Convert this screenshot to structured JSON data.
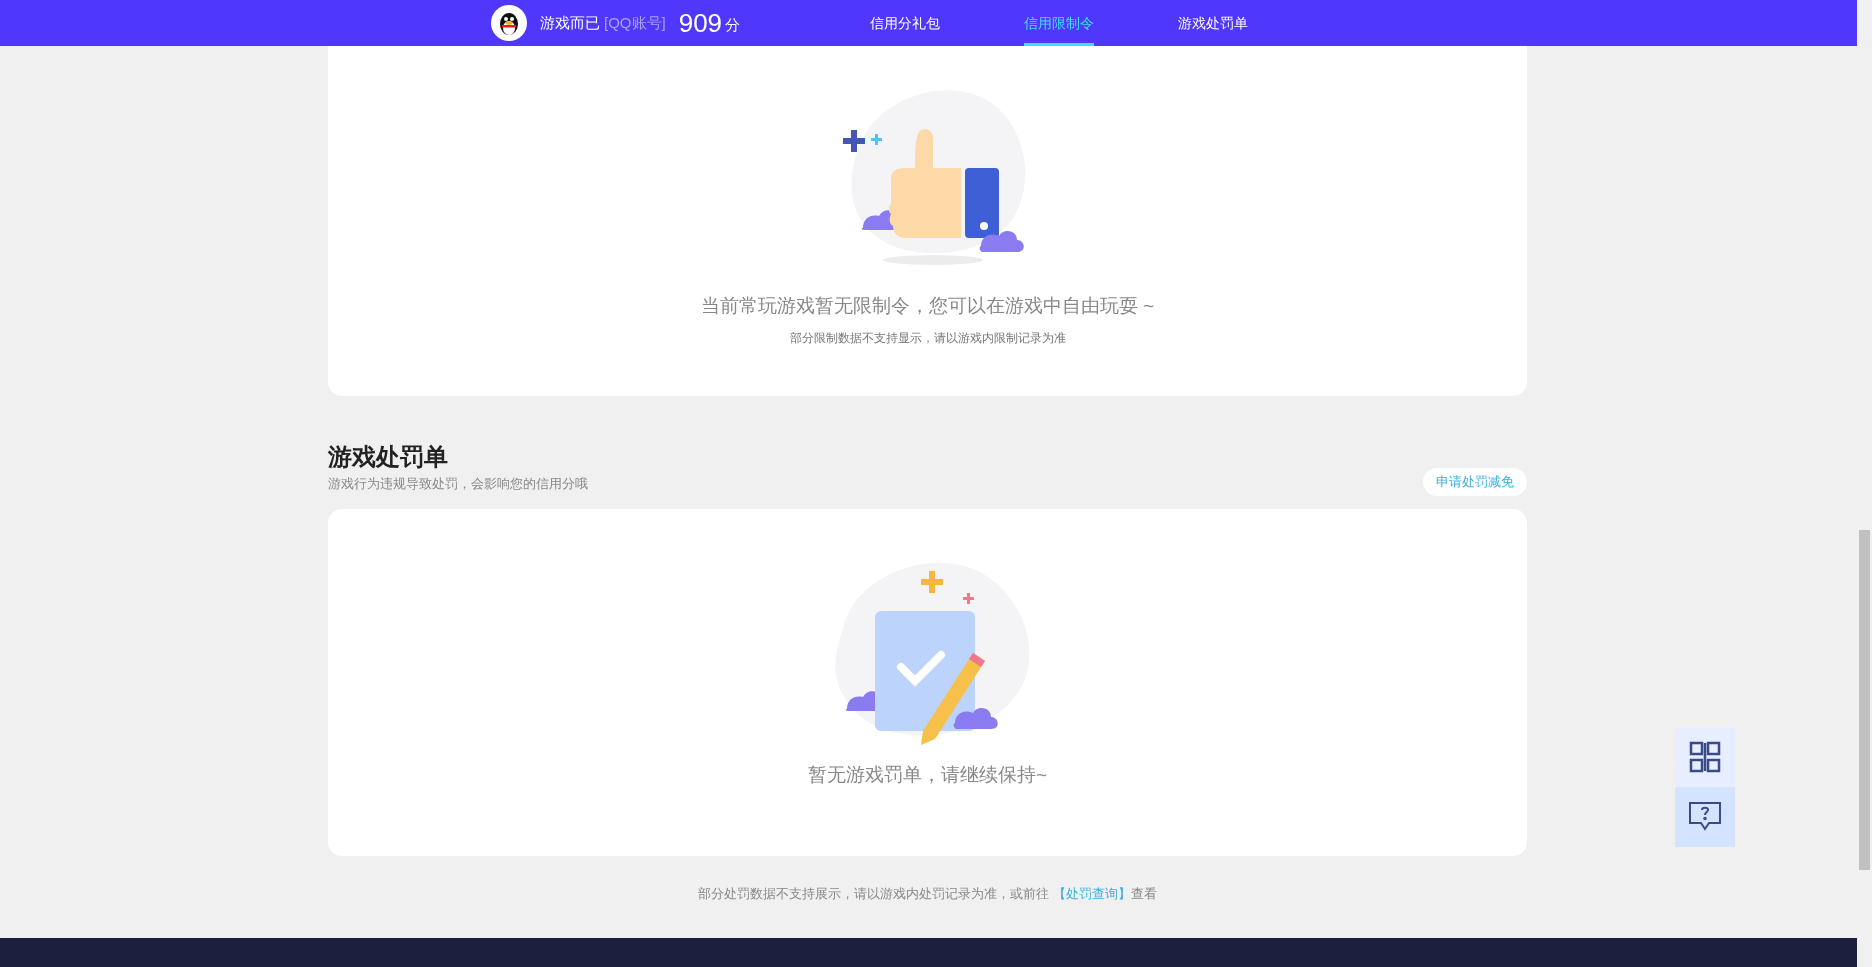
{
  "header": {
    "username": "游戏而已",
    "account_type": "[QQ账号]",
    "score": "909",
    "score_unit": "分",
    "tabs": [
      {
        "label": "信用分礼包",
        "selected": false
      },
      {
        "label": "信用限制令",
        "selected": true
      },
      {
        "label": "游戏处罚单",
        "selected": false
      }
    ]
  },
  "restriction_card": {
    "message": "当前常玩游戏暂无限制令，您可以在游戏中自由玩耍 ~",
    "note": "部分限制数据不支持显示，请以游戏内限制记录为准"
  },
  "penalty_section": {
    "title": "游戏处罚单",
    "subtitle": "游戏行为违规导致处罚，会影响您的信用分哦",
    "appeal_button": "申请处罚减免",
    "empty_message": "暂无游戏罚单，请继续保持~"
  },
  "footer_note": {
    "before": "部分处罚数据不支持展示，请以游戏内处罚记录为准，或前往 ",
    "link": "【处罚查询】",
    "after": "查看"
  }
}
